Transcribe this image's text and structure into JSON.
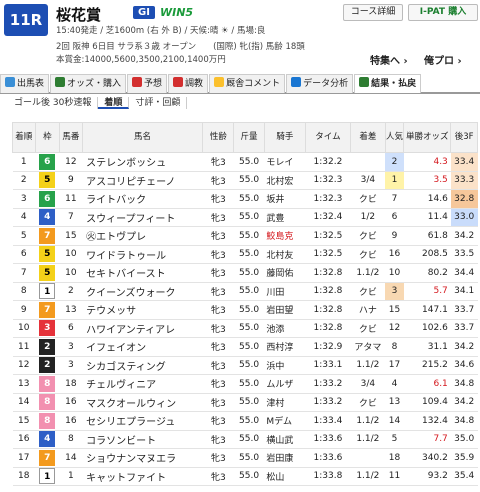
{
  "header": {
    "race_no": "11R",
    "race_name": "桜花賞",
    "grade": "GI",
    "win5": "WIN5",
    "time_course": "15:40発走 / 芝1600m (右 外 B) / 天候:晴 ☀ / 馬場:良",
    "details": "2回 阪神 6日目 サラ系３歳 オープン　　(国際) 牝(指) 馬齢 18頭",
    "prize": "本賞金:14000,5600,3500,2100,1400万円",
    "course_button": "コース詳細",
    "ipat_button": "I-PAT 購入",
    "link_tokusyu": "特集へ ›",
    "link_ore": "俺プロ ›"
  },
  "tabs": [
    {
      "label": "出馬表",
      "icon": "horse-icon",
      "color": "#3a8fd6"
    },
    {
      "label": "オッズ・購入",
      "icon": "odds-icon",
      "color": "#2e7d32"
    },
    {
      "label": "予想",
      "icon": "prediction-icon",
      "color": "#d32f2f"
    },
    {
      "label": "調教",
      "icon": "training-icon",
      "color": "#d32f2f"
    },
    {
      "label": "厩舎コメント",
      "icon": "comment-icon",
      "color": "#fbc02d"
    },
    {
      "label": "データ分析",
      "icon": "chart-icon",
      "color": "#1976d2"
    },
    {
      "label": "結果・払戻",
      "icon": "result-icon",
      "color": "#2e7d32"
    }
  ],
  "subtabs": [
    "ゴール後 30秒速報",
    "着順",
    "寸評・回顧"
  ],
  "columns": [
    "着順",
    "枠",
    "馬番",
    "馬名",
    "性齢",
    "斤量",
    "騎手",
    "タイム",
    "着差",
    "人気",
    "単勝オッズ",
    "後3F"
  ],
  "rows": [
    {
      "rank": "1",
      "waku": "6",
      "num": "12",
      "name": "ステレンボッシュ",
      "sex": "牝3",
      "weight": "55.0",
      "jockey": "モレイ",
      "time": "1:32.2",
      "margin": "",
      "pop": "2",
      "odds": "4.3",
      "l3f": "33.4"
    },
    {
      "rank": "2",
      "waku": "5",
      "num": "9",
      "name": "アスコリピチェーノ",
      "sex": "牝3",
      "weight": "55.0",
      "jockey": "北村宏",
      "time": "1:32.3",
      "margin": "3/4",
      "pop": "1",
      "odds": "3.5",
      "l3f": "33.3"
    },
    {
      "rank": "3",
      "waku": "6",
      "num": "11",
      "name": "ライトバック",
      "sex": "牝3",
      "weight": "55.0",
      "jockey": "坂井",
      "time": "1:32.3",
      "margin": "クビ",
      "pop": "7",
      "odds": "14.6",
      "l3f": "32.8"
    },
    {
      "rank": "4",
      "waku": "4",
      "num": "7",
      "name": "スウィープフィート",
      "sex": "牝3",
      "weight": "55.0",
      "jockey": "武豊",
      "time": "1:32.4",
      "margin": "1/2",
      "pop": "6",
      "odds": "11.4",
      "l3f": "33.0"
    },
    {
      "rank": "5",
      "waku": "7",
      "num": "15",
      "name": "㊋エトヴプレ",
      "sex": "牝3",
      "weight": "55.0",
      "jockey": "鮫島克",
      "time": "1:32.5",
      "margin": "クビ",
      "pop": "9",
      "odds": "61.8",
      "l3f": "34.2"
    },
    {
      "rank": "6",
      "waku": "5",
      "num": "10",
      "name": "ワイドラトゥール",
      "sex": "牝3",
      "weight": "55.0",
      "jockey": "北村友",
      "time": "1:32.5",
      "margin": "クビ",
      "pop": "16",
      "odds": "208.5",
      "l3f": "33.5"
    },
    {
      "rank": "7",
      "waku": "5",
      "num": "10",
      "name": "セキトバイースト",
      "sex": "牝3",
      "weight": "55.0",
      "jockey": "藤岡佑",
      "time": "1:32.8",
      "margin": "1.1/2",
      "pop": "10",
      "odds": "80.2",
      "l3f": "34.4"
    },
    {
      "rank": "8",
      "waku": "1",
      "num": "2",
      "name": "クイーンズウォーク",
      "sex": "牝3",
      "weight": "55.0",
      "jockey": "川田",
      "time": "1:32.8",
      "margin": "クビ",
      "pop": "3",
      "odds": "5.7",
      "l3f": "34.1"
    },
    {
      "rank": "9",
      "waku": "7",
      "num": "13",
      "name": "テウメッサ",
      "sex": "牝3",
      "weight": "55.0",
      "jockey": "岩田望",
      "time": "1:32.8",
      "margin": "ハナ",
      "pop": "15",
      "odds": "147.1",
      "l3f": "33.7"
    },
    {
      "rank": "10",
      "waku": "3",
      "num": "6",
      "name": "ハワイアンティアレ",
      "sex": "牝3",
      "weight": "55.0",
      "jockey": "池添",
      "time": "1:32.8",
      "margin": "クビ",
      "pop": "12",
      "odds": "102.6",
      "l3f": "33.7"
    },
    {
      "rank": "11",
      "waku": "2",
      "num": "3",
      "name": "イフェイオン",
      "sex": "牝3",
      "weight": "55.0",
      "jockey": "西村淳",
      "time": "1:32.9",
      "margin": "アタマ",
      "pop": "8",
      "odds": "31.1",
      "l3f": "34.2"
    },
    {
      "rank": "12",
      "waku": "2",
      "num": "3",
      "name": "シカゴスティング",
      "sex": "牝3",
      "weight": "55.0",
      "jockey": "浜中",
      "time": "1:33.1",
      "margin": "1.1/2",
      "pop": "17",
      "odds": "215.2",
      "l3f": "34.6"
    },
    {
      "rank": "13",
      "waku": "8",
      "num": "18",
      "name": "チェルヴィニア",
      "sex": "牝3",
      "weight": "55.0",
      "jockey": "ムルザ",
      "time": "1:33.2",
      "margin": "3/4",
      "pop": "4",
      "odds": "6.1",
      "l3f": "34.8"
    },
    {
      "rank": "14",
      "waku": "8",
      "num": "16",
      "name": "マスクオールウィン",
      "sex": "牝3",
      "weight": "55.0",
      "jockey": "津村",
      "time": "1:33.2",
      "margin": "クビ",
      "pop": "13",
      "odds": "109.4",
      "l3f": "34.2"
    },
    {
      "rank": "15",
      "waku": "8",
      "num": "16",
      "name": "セシリエプラージュ",
      "sex": "牝3",
      "weight": "55.0",
      "jockey": "Mデム",
      "time": "1:33.4",
      "margin": "1.1/2",
      "pop": "14",
      "odds": "132.4",
      "l3f": "34.8"
    },
    {
      "rank": "16",
      "waku": "4",
      "num": "8",
      "name": "コラソンビート",
      "sex": "牝3",
      "weight": "55.0",
      "jockey": "横山武",
      "time": "1:33.6",
      "margin": "1.1/2",
      "pop": "5",
      "odds": "7.7",
      "l3f": "35.0"
    },
    {
      "rank": "17",
      "waku": "7",
      "num": "14",
      "name": "ショウナンマヌエラ",
      "sex": "牝3",
      "weight": "55.0",
      "jockey": "岩田康",
      "time": "1:33.6",
      "margin": "",
      "pop": "18",
      "odds": "340.2",
      "l3f": "35.9"
    },
    {
      "rank": "18",
      "waku": "1",
      "num": "1",
      "name": "キャットファイト",
      "sex": "牝3",
      "weight": "55.0",
      "jockey": "松山",
      "time": "1:33.8",
      "margin": "1.1/2",
      "pop": "11",
      "odds": "93.2",
      "l3f": "35.4"
    }
  ]
}
